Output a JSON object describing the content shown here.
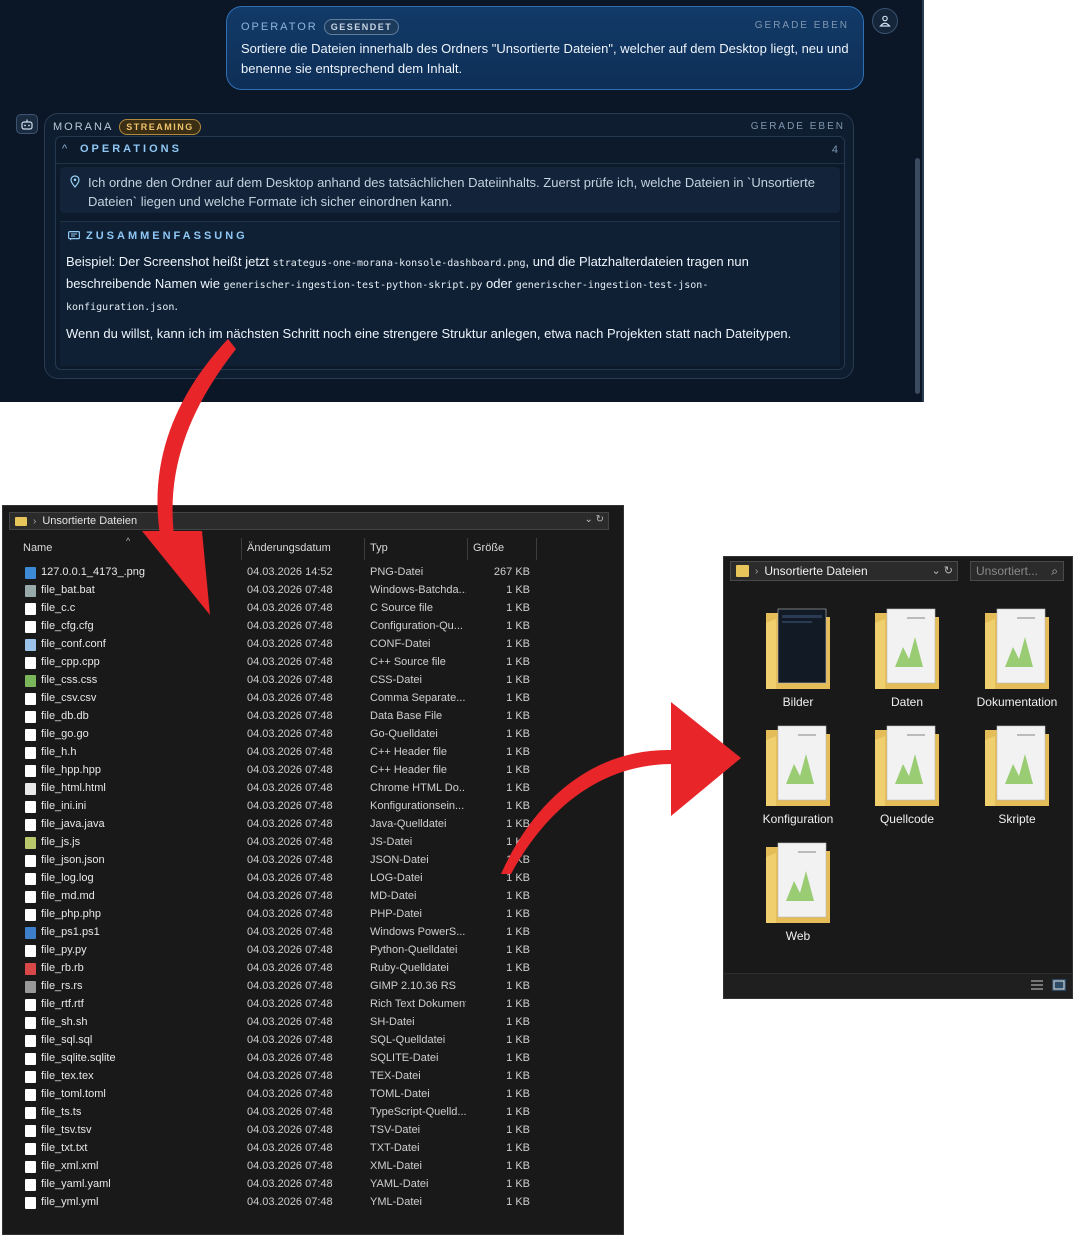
{
  "chat": {
    "operator": {
      "role": "OPERATOR",
      "badge": "GESENDET",
      "time": "GERADE EBEN",
      "text": "Sortiere die Dateien innerhalb des Ordners \"Unsortierte Dateien\", welcher auf dem Desktop liegt, neu und benenne sie entsprechend dem Inhalt."
    },
    "morana": {
      "role": "MORANA",
      "badge": "STREAMING",
      "time": "GERADE EBEN",
      "operations_title": "OPERATIONS",
      "operations_count": "4",
      "operation_text": "Ich ordne den Ordner auf dem Desktop anhand des tatsächlichen Dateiinhalts. Zuerst prüfe ich, welche Dateien in `Unsortierte Dateien` liegen und welche Formate ich sicher einordnen kann.",
      "summary_title": "ZUSAMMENFASSUNG",
      "summary_p1_a": "Beispiel: Der Screenshot heißt jetzt ",
      "summary_p1_code1": "strategus-one-morana-konsole-dashboard.png",
      "summary_p1_b": ", und die Platzhalterdateien tragen nun beschreibende Namen wie ",
      "summary_p1_code2": "generischer-ingestion-test-python-skript.py",
      "summary_p1_c": " oder ",
      "summary_p1_code3": "generischer-ingestion-test-json-konfiguration.json",
      "summary_p1_d": ".",
      "summary_p2": "Wenn du willst, kann ich im nächsten Schritt noch eine strengere Struktur anlegen, etwa nach Projekten statt nach Dateitypen."
    }
  },
  "explorer_list": {
    "breadcrumb": "Unsortierte Dateien",
    "columns": {
      "name": "Name",
      "date": "Änderungsdatum",
      "type": "Typ",
      "size": "Größe"
    },
    "rows": [
      {
        "name": "127.0.0.1_4173_.png",
        "date": "04.03.2026 14:52",
        "type": "PNG-Datei",
        "size": "267 KB"
      },
      {
        "name": "file_bat.bat",
        "date": "04.03.2026 07:48",
        "type": "Windows-Batchda...",
        "size": "1 KB"
      },
      {
        "name": "file_c.c",
        "date": "04.03.2026 07:48",
        "type": "C Source file",
        "size": "1 KB"
      },
      {
        "name": "file_cfg.cfg",
        "date": "04.03.2026 07:48",
        "type": "Configuration-Qu...",
        "size": "1 KB"
      },
      {
        "name": "file_conf.conf",
        "date": "04.03.2026 07:48",
        "type": "CONF-Datei",
        "size": "1 KB"
      },
      {
        "name": "file_cpp.cpp",
        "date": "04.03.2026 07:48",
        "type": "C++ Source file",
        "size": "1 KB"
      },
      {
        "name": "file_css.css",
        "date": "04.03.2026 07:48",
        "type": "CSS-Datei",
        "size": "1 KB"
      },
      {
        "name": "file_csv.csv",
        "date": "04.03.2026 07:48",
        "type": "Comma Separate...",
        "size": "1 KB"
      },
      {
        "name": "file_db.db",
        "date": "04.03.2026 07:48",
        "type": "Data Base File",
        "size": "1 KB"
      },
      {
        "name": "file_go.go",
        "date": "04.03.2026 07:48",
        "type": "Go-Quelldatei",
        "size": "1 KB"
      },
      {
        "name": "file_h.h",
        "date": "04.03.2026 07:48",
        "type": "C++ Header file",
        "size": "1 KB"
      },
      {
        "name": "file_hpp.hpp",
        "date": "04.03.2026 07:48",
        "type": "C++ Header file",
        "size": "1 KB"
      },
      {
        "name": "file_html.html",
        "date": "04.03.2026 07:48",
        "type": "Chrome HTML Do...",
        "size": "1 KB"
      },
      {
        "name": "file_ini.ini",
        "date": "04.03.2026 07:48",
        "type": "Konfigurationsein...",
        "size": "1 KB"
      },
      {
        "name": "file_java.java",
        "date": "04.03.2026 07:48",
        "type": "Java-Quelldatei",
        "size": "1 KB"
      },
      {
        "name": "file_js.js",
        "date": "04.03.2026 07:48",
        "type": "JS-Datei",
        "size": "1 KB"
      },
      {
        "name": "file_json.json",
        "date": "04.03.2026 07:48",
        "type": "JSON-Datei",
        "size": "1 KB"
      },
      {
        "name": "file_log.log",
        "date": "04.03.2026 07:48",
        "type": "LOG-Datei",
        "size": "1 KB"
      },
      {
        "name": "file_md.md",
        "date": "04.03.2026 07:48",
        "type": "MD-Datei",
        "size": "1 KB"
      },
      {
        "name": "file_php.php",
        "date": "04.03.2026 07:48",
        "type": "PHP-Datei",
        "size": "1 KB"
      },
      {
        "name": "file_ps1.ps1",
        "date": "04.03.2026 07:48",
        "type": "Windows PowerS...",
        "size": "1 KB"
      },
      {
        "name": "file_py.py",
        "date": "04.03.2026 07:48",
        "type": "Python-Quelldatei",
        "size": "1 KB"
      },
      {
        "name": "file_rb.rb",
        "date": "04.03.2026 07:48",
        "type": "Ruby-Quelldatei",
        "size": "1 KB"
      },
      {
        "name": "file_rs.rs",
        "date": "04.03.2026 07:48",
        "type": "GIMP 2.10.36 RS",
        "size": "1 KB"
      },
      {
        "name": "file_rtf.rtf",
        "date": "04.03.2026 07:48",
        "type": "Rich Text Dokument",
        "size": "1 KB"
      },
      {
        "name": "file_sh.sh",
        "date": "04.03.2026 07:48",
        "type": "SH-Datei",
        "size": "1 KB"
      },
      {
        "name": "file_sql.sql",
        "date": "04.03.2026 07:48",
        "type": "SQL-Quelldatei",
        "size": "1 KB"
      },
      {
        "name": "file_sqlite.sqlite",
        "date": "04.03.2026 07:48",
        "type": "SQLITE-Datei",
        "size": "1 KB"
      },
      {
        "name": "file_tex.tex",
        "date": "04.03.2026 07:48",
        "type": "TEX-Datei",
        "size": "1 KB"
      },
      {
        "name": "file_toml.toml",
        "date": "04.03.2026 07:48",
        "type": "TOML-Datei",
        "size": "1 KB"
      },
      {
        "name": "file_ts.ts",
        "date": "04.03.2026 07:48",
        "type": "TypeScript-Quelld...",
        "size": "1 KB"
      },
      {
        "name": "file_tsv.tsv",
        "date": "04.03.2026 07:48",
        "type": "TSV-Datei",
        "size": "1 KB"
      },
      {
        "name": "file_txt.txt",
        "date": "04.03.2026 07:48",
        "type": "TXT-Datei",
        "size": "1 KB"
      },
      {
        "name": "file_xml.xml",
        "date": "04.03.2026 07:48",
        "type": "XML-Datei",
        "size": "1 KB"
      },
      {
        "name": "file_yaml.yaml",
        "date": "04.03.2026 07:48",
        "type": "YAML-Datei",
        "size": "1 KB"
      },
      {
        "name": "file_yml.yml",
        "date": "04.03.2026 07:48",
        "type": "YML-Datei",
        "size": "1 KB"
      }
    ]
  },
  "explorer_icons": {
    "breadcrumb": "Unsortierte Dateien",
    "search_placeholder": "Unsortiert...",
    "folders": [
      "Bilder",
      "Daten",
      "Dokumentation",
      "Konfiguration",
      "Quellcode",
      "Skripte",
      "Web"
    ]
  },
  "colors": {
    "arrow": "#e8262a",
    "chat_bg": "#0b1626",
    "accent": "#8fc7f5",
    "folder": "#e8c55a"
  }
}
